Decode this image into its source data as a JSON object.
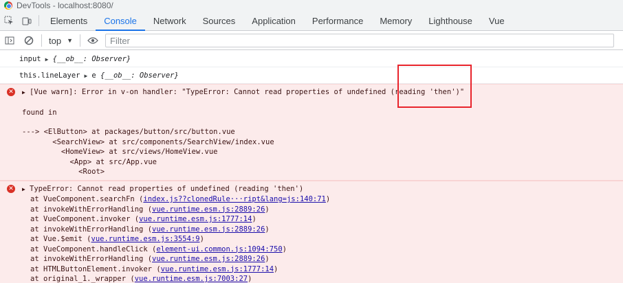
{
  "window": {
    "title": "DevTools - localhost:8080/"
  },
  "tabs": [
    {
      "label": "Elements",
      "active": false
    },
    {
      "label": "Console",
      "active": true
    },
    {
      "label": "Network",
      "active": false
    },
    {
      "label": "Sources",
      "active": false
    },
    {
      "label": "Application",
      "active": false
    },
    {
      "label": "Performance",
      "active": false
    },
    {
      "label": "Memory",
      "active": false
    },
    {
      "label": "Lighthouse",
      "active": false
    },
    {
      "label": "Vue",
      "active": false
    }
  ],
  "toolbar": {
    "context": "top",
    "filter_placeholder": "Filter"
  },
  "console": {
    "log1": {
      "label": "input",
      "value": "{__ob__: Observer}"
    },
    "log2": {
      "label": "this.lineLayer",
      "prefix": "e",
      "value": "{__ob__: Observer}"
    },
    "error1": {
      "message": "[Vue warn]: Error in v-on handler: \"TypeError: Cannot read properties of undefined (reading 'then')\"",
      "found_in": "found in",
      "trace": [
        "---> <ElButton> at packages/button/src/button.vue",
        "       <SearchView> at src/components/SearchView/index.vue",
        "         <HomeView> at src/views/HomeView.vue",
        "           <App> at src/App.vue",
        "             <Root>"
      ]
    },
    "error2": {
      "message": "TypeError: Cannot read properties of undefined (reading 'then')",
      "stack": [
        {
          "fn": "at VueComponent.searchFn",
          "link": "index.js??clonedRule···ript&lang=js:140:71"
        },
        {
          "fn": "at invokeWithErrorHandling",
          "link": "vue.runtime.esm.js:2889:26"
        },
        {
          "fn": "at VueComponent.invoker",
          "link": "vue.runtime.esm.js:1777:14"
        },
        {
          "fn": "at invokeWithErrorHandling",
          "link": "vue.runtime.esm.js:2889:26"
        },
        {
          "fn": "at Vue.$emit",
          "link": "vue.runtime.esm.js:3554:9"
        },
        {
          "fn": "at VueComponent.handleClick",
          "link": "element-ui.common.js:1094:750"
        },
        {
          "fn": "at invokeWithErrorHandling",
          "link": "vue.runtime.esm.js:2889:26"
        },
        {
          "fn": "at HTMLButtonElement.invoker",
          "link": "vue.runtime.esm.js:1777:14"
        },
        {
          "fn": "at original_1._wrapper",
          "link": "vue.runtime.esm.js:7003:27"
        }
      ]
    }
  },
  "colors": {
    "accent": "#1a73e8",
    "error_bg": "#fcebeb",
    "error_icon": "#d93025",
    "highlight": "#e8232b"
  }
}
